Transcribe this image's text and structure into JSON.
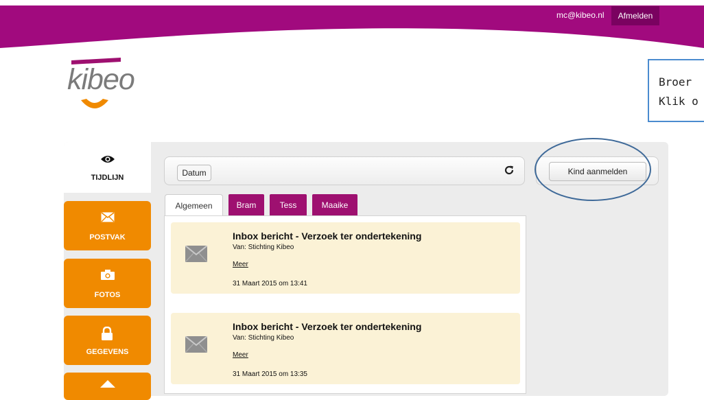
{
  "header": {
    "user_email": "mc@kibeo.nl",
    "logout_label": "Afmelden",
    "brand_color": "#a10a7e"
  },
  "logo": {
    "text": "kibeo"
  },
  "callout": {
    "line1": "Broer",
    "line2": "Klik o"
  },
  "sidebar": {
    "timeline_label": "TIJDLIJN",
    "items": [
      {
        "label": "POSTVAK",
        "icon": "envelope-icon"
      },
      {
        "label": "FOTOS",
        "icon": "camera-icon"
      },
      {
        "label": "GEGEVENS",
        "icon": "lock-icon"
      }
    ]
  },
  "toolbar": {
    "date_label": "Datum",
    "register_child_label": "Kind aanmelden"
  },
  "tabs": [
    {
      "label": "Algemeen",
      "active": true
    },
    {
      "label": "Bram",
      "active": false
    },
    {
      "label": "Tess",
      "active": false
    },
    {
      "label": "Maaike",
      "active": false
    }
  ],
  "messages": [
    {
      "title": "Inbox bericht - Verzoek ter ondertekening",
      "from": "Van: Stichting Kibeo",
      "more": "Meer",
      "date": "31 Maart 2015 om 13:41"
    },
    {
      "title": "Inbox bericht - Verzoek ter ondertekening",
      "from": "Van: Stichting Kibeo",
      "more": "Meer",
      "date": "31 Maart 2015 om 13:35"
    }
  ]
}
